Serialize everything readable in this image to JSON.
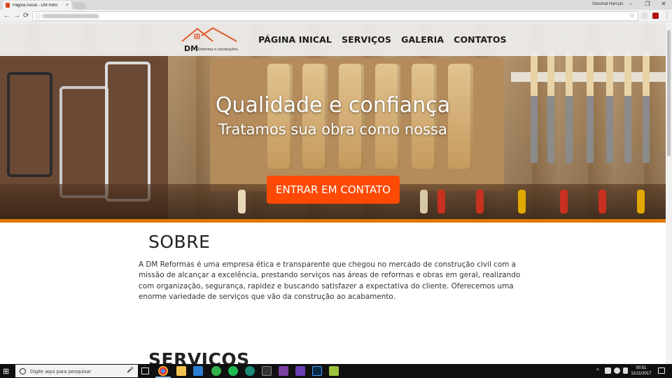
{
  "browser": {
    "tab_title": "Página inicial - DM Refo",
    "tab_close": "×",
    "profile_name": "Gloomal Harcuis",
    "back": "←",
    "forward": "→",
    "reload": "⟳",
    "info": "ⓘ",
    "star": "☆",
    "menu": "⋮",
    "min": "–",
    "max": "❐",
    "close": "✕"
  },
  "site": {
    "logo_initials": "DM",
    "logo_subtitle": "Reforma e construções",
    "nav": [
      "PÁGINA INICAL",
      "SERVIÇOS",
      "GALERIA",
      "CONTATOS"
    ],
    "hero_title": "Qualidade e confiança",
    "hero_subtitle": "Tratamos sua obra como nossa",
    "cta_label": "ENTRAR EM CONTATO",
    "sobre_title": "SOBRE",
    "sobre_text": "A DM Reformas é uma empresa ética e transparente que chegou no mercado de construção civil com a missão de alcançar a excelência, prestando serviços nas áreas de reformas e obras em geral, realizando com organização, segurança, rapidez e buscando satisfazer a expectativa do cliente. Oferecemos uma enorme variedade de serviços que vão da construção ao acabamento.",
    "servicos_title": "SERVIÇOS",
    "accent_color": "#ff4a05",
    "stripe_color": "#e07a00"
  },
  "taskbar": {
    "start": "⊞",
    "search_placeholder": "Digite aqui para pesquisar",
    "mic": "🎤",
    "time": "00:51",
    "date": "11/11/2017",
    "tray_arrow": "^"
  }
}
